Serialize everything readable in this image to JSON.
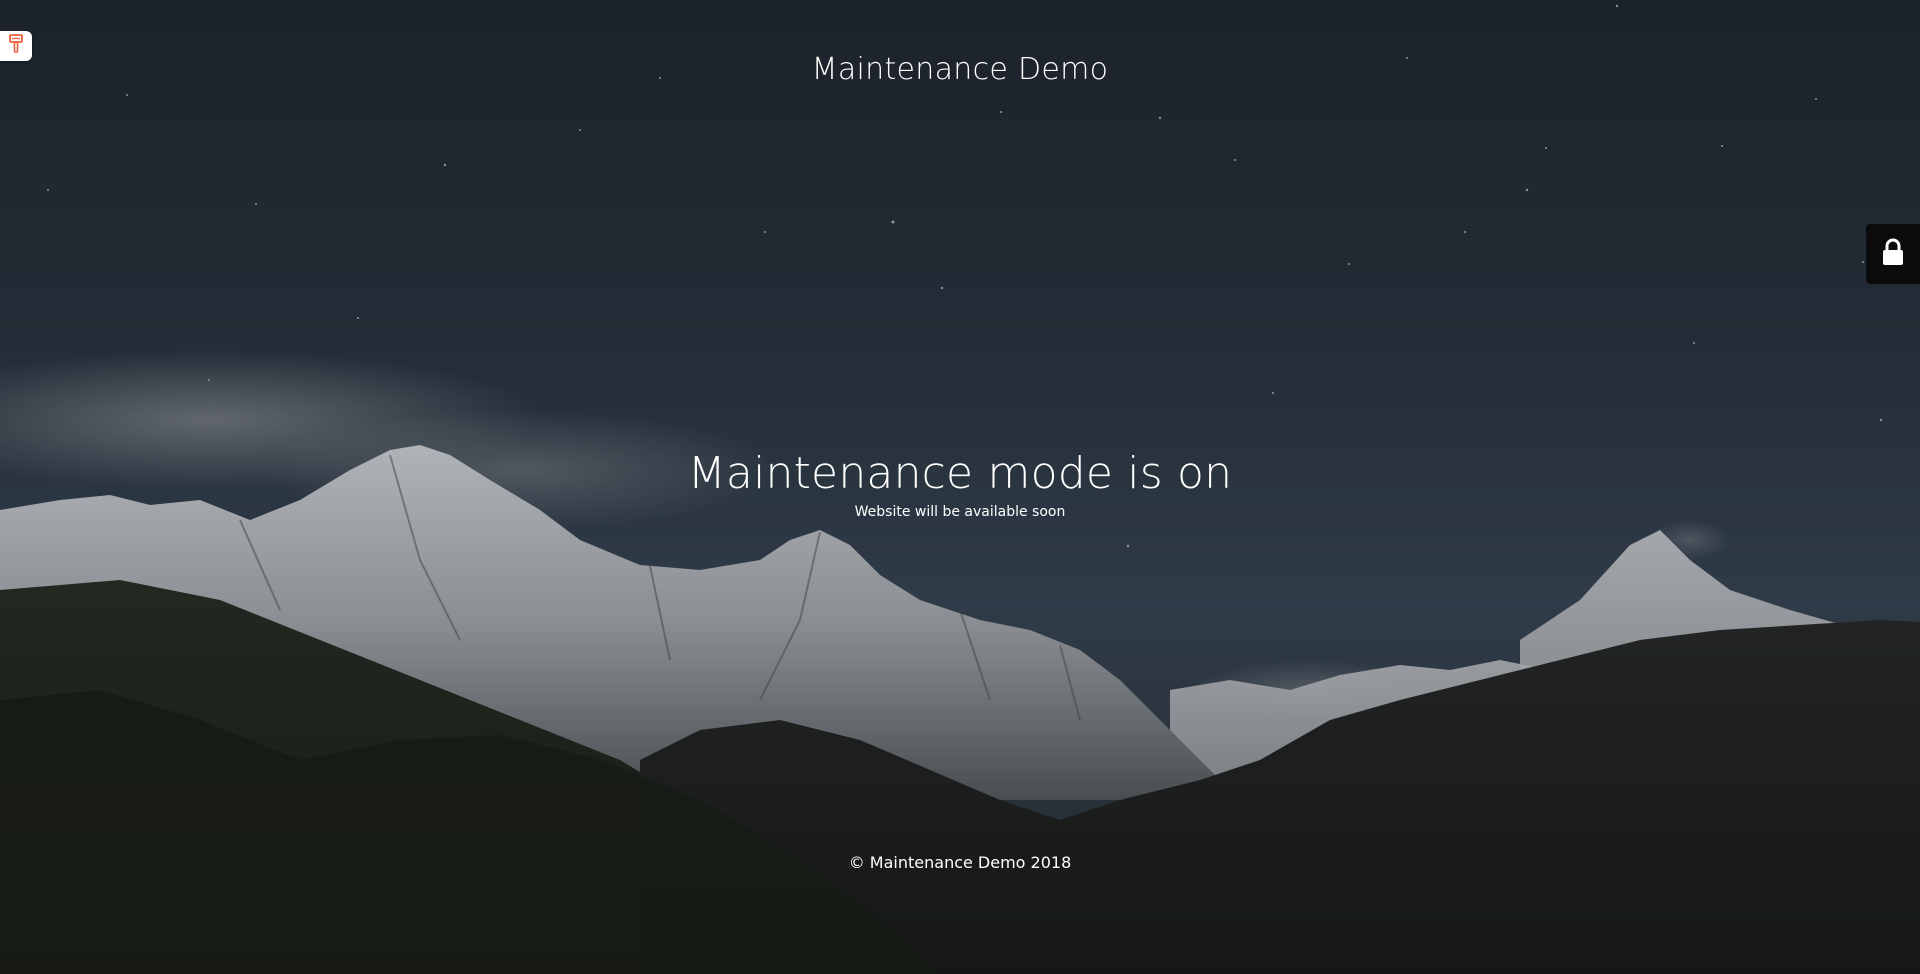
{
  "site": {
    "title": "Maintenance Demo"
  },
  "main": {
    "headline": "Maintenance mode is on",
    "subtext": "Website will be available soon"
  },
  "footer": {
    "copyright": "© Maintenance Demo 2018"
  },
  "controls": {
    "customize_icon": "paintbrush-icon",
    "login_icon": "lock-icon"
  },
  "colors": {
    "text": "#ffffff",
    "accent_brush": "#e8603c",
    "lock_panel": "#0b0b0b",
    "sky_top": "#232a33",
    "sky_mid": "#364452"
  }
}
